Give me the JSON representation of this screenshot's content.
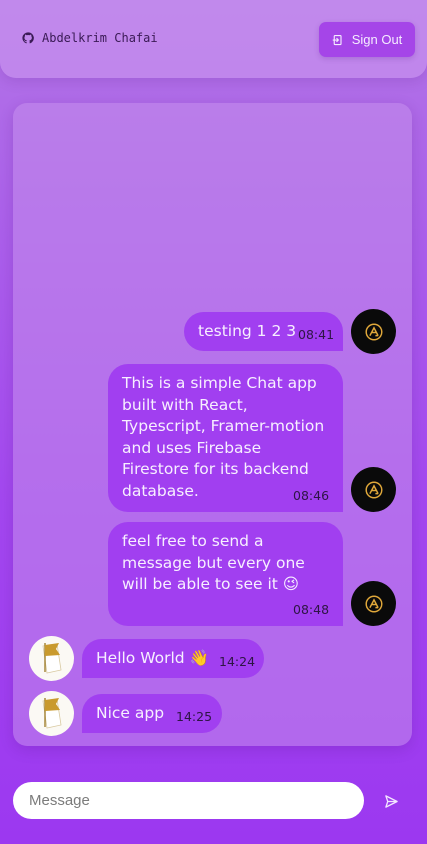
{
  "header": {
    "username": "Abdelkrim Chafai",
    "github_icon": "github-icon",
    "sign_out_label": "Sign Out",
    "sign_out_icon": "sign-out-icon"
  },
  "messages": [
    {
      "side": "own",
      "text": "testing 1 2 3",
      "time": "08:41"
    },
    {
      "side": "own",
      "text": "This is a simple Chat app built with React, Typescript, Framer-motion and uses Firebase Firestore for its backend database.",
      "time": "08:46"
    },
    {
      "side": "own",
      "text": "feel free to send a message but every one will be able to see it 😉",
      "time": "08:48"
    },
    {
      "side": "other",
      "text": "Hello World 👋",
      "time": "14:24"
    },
    {
      "side": "other",
      "text": "Nice app",
      "time": "14:25"
    }
  ],
  "composer": {
    "placeholder": "Message",
    "send_icon": "send-icon"
  },
  "colors": {
    "bubble": "#a13ff0",
    "signout": "#a545e8",
    "background": "#a347ef"
  }
}
